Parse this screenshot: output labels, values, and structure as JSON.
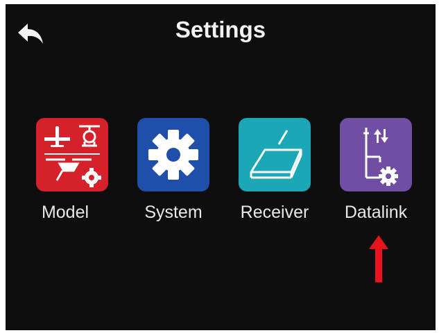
{
  "header": {
    "title": "Settings",
    "back_icon": "back-arrow-icon"
  },
  "menu": {
    "items": [
      {
        "label": "Model",
        "icon": "model-aircraft-icon",
        "color": "#d6202a"
      },
      {
        "label": "System",
        "icon": "gear-icon",
        "color": "#1f4fa8"
      },
      {
        "label": "Receiver",
        "icon": "receiver-icon",
        "color": "#1ba7b5"
      },
      {
        "label": "Datalink",
        "icon": "datalink-icon",
        "color": "#6f4ea3"
      }
    ]
  },
  "annotation": {
    "icon": "red-up-arrow-icon",
    "color": "#e8141b"
  },
  "colors": {
    "background": "#0e0e0f",
    "text": "#f2f2f2"
  }
}
